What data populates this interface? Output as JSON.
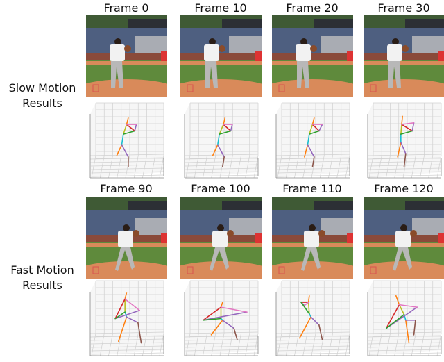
{
  "rows": [
    {
      "label_line1": "Slow Motion",
      "label_line2": "Results",
      "frames": [
        {
          "title": "Frame 0",
          "pose": "stand-a"
        },
        {
          "title": "Frame 10",
          "pose": "stand-b"
        },
        {
          "title": "Frame 20",
          "pose": "stand-c"
        },
        {
          "title": "Frame 30",
          "pose": "stand-d"
        }
      ]
    },
    {
      "label_line1": "Fast Motion",
      "label_line2": "Results",
      "frames": [
        {
          "title": "Frame 90",
          "pose": "stride-a"
        },
        {
          "title": "Frame 100",
          "pose": "stride-b"
        },
        {
          "title": "Frame 110",
          "pose": "stride-c"
        },
        {
          "title": "Frame 120",
          "pose": "stride-d"
        }
      ]
    }
  ],
  "colors": {
    "sky": "#3f5a35",
    "building": "#4e5f80",
    "wall": "#8a4a3a",
    "grass": "#5f8a3c",
    "dirt": "#d98a5a",
    "uniform": "#f2f2f2",
    "pants": "#b8b8b8",
    "grid_bg": "#f6f6f6",
    "grid_line": "#d0d0d0",
    "bone_colors": [
      "#ff7f0e",
      "#1f77b4",
      "#2ca02c",
      "#d62728",
      "#9467bd",
      "#8c564b",
      "#e377c2",
      "#7f7f7f",
      "#bcbd22",
      "#17becf"
    ]
  }
}
